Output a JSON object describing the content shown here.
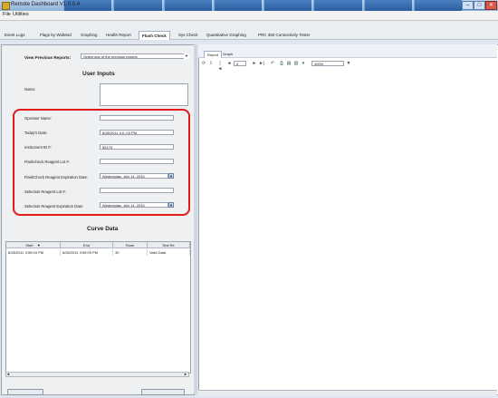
{
  "window": {
    "title": "Remote Dashboard  V1.0.0.4",
    "minimize": "–",
    "maximize": "□",
    "close": "✕"
  },
  "menu": {
    "file": "File",
    "utilities": "Utilities"
  },
  "tabs": [
    {
      "label": "Event Logs"
    },
    {
      "label": "Flags by WidMod"
    },
    {
      "label": "Graphing"
    },
    {
      "label": "Health Report"
    },
    {
      "label": "Flush Check"
    },
    {
      "label": "Sys Check"
    },
    {
      "label": "Quantitative Graphing"
    },
    {
      "label": "PRC 360 Connectivity Tester"
    }
  ],
  "left": {
    "view_previous_label": "View Previous Reports:",
    "view_previous_value": "Select any of the previous reports",
    "user_inputs_title": "User Inputs",
    "notes_label": "Notes:",
    "operator_label": "Operator Name:",
    "date_label": "Today's Date:",
    "date_value": "6/28/2011 4:0 :03 PM",
    "instrument_label": "Instrument ID #:",
    "instrument_value": "55175",
    "flashcheck_lot_label": "Flashcheck Reagent Lot #:",
    "flashcheck_exp_label": "FlashCheck Reagent Expiration Date:",
    "flashcheck_exp_value": "Wednesday, July 14, 2010",
    "selection_lot_label": "Selection Reagent Lot #:",
    "selection_exp_label": "Selection Reagent Expiration Date:",
    "selection_exp_value": "Wednesday, July 14, 2010",
    "curve_data_title": "Curve Data",
    "grid_headers": [
      "Start",
      "End",
      "Runs",
      "Test Re"
    ],
    "grid_row": [
      "6/28/2011 3:59:04 PM",
      "6/28/2011 3:59:09 PM",
      "30",
      "Valid Data"
    ]
  },
  "right": {
    "tabs": [
      "Report",
      "Graph"
    ],
    "page_value": "0",
    "zoom_value": "100%"
  },
  "icons": {
    "dropdown": "▼",
    "scroll_left": "◄",
    "scroll_right": "►"
  }
}
